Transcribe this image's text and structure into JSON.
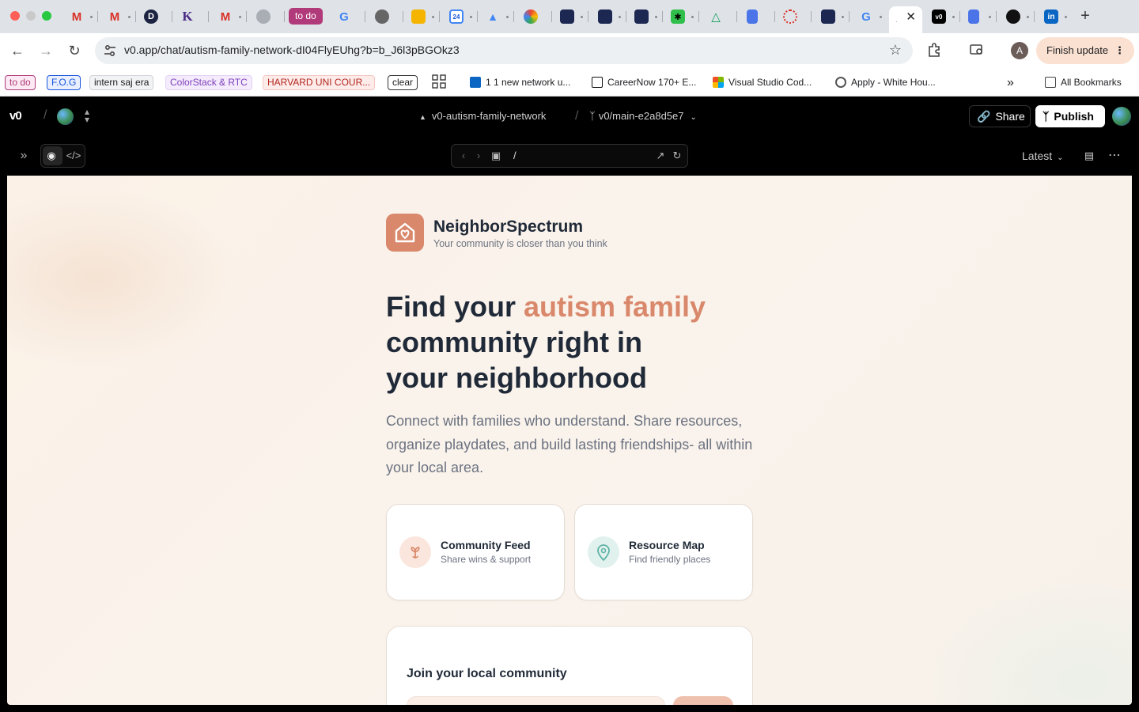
{
  "browser": {
    "tabs": {
      "todo_tab_label": "to do"
    },
    "address": {
      "url": "v0.app/chat/autism-family-network-dI04FlyEUhg?b=b_J6l3pBGOkz3"
    },
    "finish_update_label": "Finish update",
    "profile_initial": "A",
    "bookmarks": [
      {
        "label": "to do",
        "color": "#b13a7a"
      },
      {
        "label": "F.O.G",
        "color": "#1a56db"
      },
      {
        "label": "intern saj era"
      },
      {
        "label": "ColorStack & RTC",
        "color": "#7e3fb8"
      },
      {
        "label": "HARVARD UNI COUR...",
        "color": "#b3261e"
      },
      {
        "label": "clear"
      },
      {
        "label": "1 1 new network u..."
      },
      {
        "label": "CareerNow 170+ E..."
      },
      {
        "label": "Visual Studio Cod..."
      },
      {
        "label": "Apply - White Hou..."
      },
      {
        "label": "All Bookmarks"
      }
    ]
  },
  "v0": {
    "project_name": "v0-autism-family-network",
    "path_separator": "/",
    "branch": "v0/main-e2a8d5e7",
    "share_label": "Share",
    "publish_label": "Publish",
    "preview_path": "/",
    "version_label": "Latest"
  },
  "site": {
    "brand_name": "NeighborSpectrum",
    "tagline": "Your community is closer than you think",
    "hero": {
      "line1_prefix": "Find your ",
      "line1_accent": "autism family",
      "line2": "community right in",
      "line3": "your neighborhood"
    },
    "lead": "Connect with families who understand. Share resources, organize playdates, and build lasting friendships- all within your local area.",
    "cards": [
      {
        "title": "Community Feed",
        "subtitle": "Share wins & support",
        "icon": "sprout-icon"
      },
      {
        "title": "Resource Map",
        "subtitle": "Find friendly places",
        "icon": "map-pin-icon"
      }
    ],
    "join_title": "Join your local community"
  },
  "colors": {
    "accent": "#d9886b",
    "text_dark": "#1f2937",
    "muted": "#6b7280",
    "map_teal": "#5fb3a6"
  }
}
